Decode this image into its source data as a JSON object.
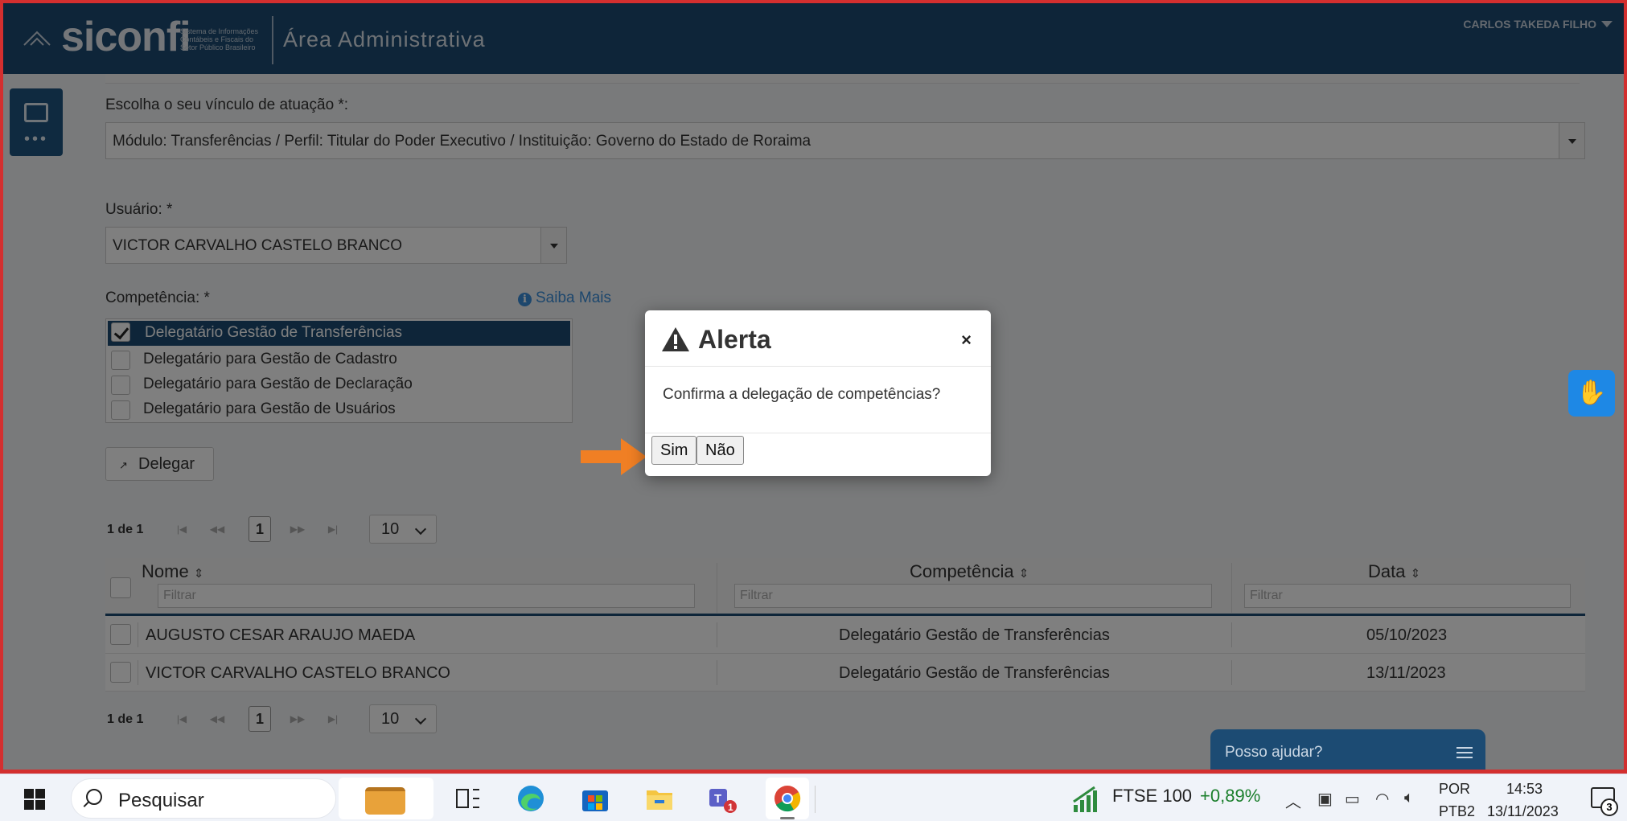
{
  "header": {
    "logo": "siconfi",
    "logo_subtitle": "Sistema de Informações Contábeis e Fiscais do Setor Público Brasileiro",
    "area_title": "Área Administrativa",
    "user_name": "CARLOS TAKEDA FILHO"
  },
  "form": {
    "vinculo_label": "Escolha o seu vínculo de atuação *:",
    "vinculo_value": "Módulo: Transferências / Perfil: Titular do Poder Executivo / Instituição: Governo do Estado de Roraima",
    "usuario_label": "Usuário: *",
    "usuario_value": "VICTOR CARVALHO CASTELO BRANCO",
    "competencia_label": "Competência: *",
    "saiba_mais": "Saiba Mais",
    "competencias": [
      {
        "label": "Delegatário Gestão de Transferências",
        "checked": true
      },
      {
        "label": "Delegatário para Gestão de Cadastro",
        "checked": false
      },
      {
        "label": "Delegatário para Gestão de Declaração",
        "checked": false
      },
      {
        "label": "Delegatário para Gestão de Usuários",
        "checked": false
      }
    ],
    "delegar_label": "Delegar"
  },
  "pager": {
    "count": "1 de 1",
    "current_page": "1",
    "page_size": "10"
  },
  "table": {
    "columns": [
      "Nome",
      "Competência",
      "Data"
    ],
    "filter_placeholder": "Filtrar",
    "rows": [
      [
        "AUGUSTO CESAR ARAUJO MAEDA",
        "Delegatário Gestão de Transferências",
        "05/10/2023"
      ],
      [
        "VICTOR CARVALHO CASTELO BRANCO",
        "Delegatário Gestão de Transferências",
        "13/11/2023"
      ]
    ]
  },
  "help_chat": "Posso ajudar?",
  "dialog": {
    "title": "Alerta",
    "close": "×",
    "message": "Confirma a delegação de competências?",
    "yes": "Sim",
    "no": "Não"
  },
  "taskbar": {
    "search": "Pesquisar",
    "ticker_name": "FTSE 100",
    "ticker_change": "+0,89%",
    "lang": "POR",
    "layout": "PTB2",
    "time": "14:53",
    "date": "13/11/2023",
    "notifications": "3"
  },
  "colors": {
    "header": "#1c4b73",
    "accent_blue": "#1e88e5",
    "arrow": "#f07f24",
    "border_red": "#d32f2f"
  }
}
